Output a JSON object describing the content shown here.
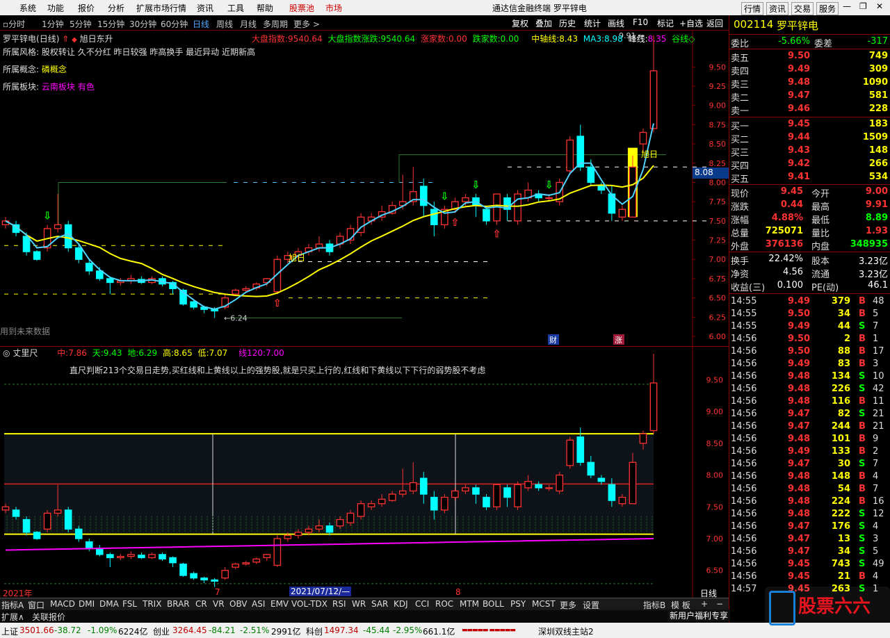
{
  "menu": {
    "items": [
      "系统",
      "功能",
      "报价",
      "分析",
      "扩展市场行情",
      "资讯",
      "工具",
      "帮助"
    ],
    "stock_pool": "股票池",
    "market": "市场",
    "title": "通达信金融终端 罗平锌电",
    "right": [
      "行情",
      "资讯",
      "交易",
      "服务"
    ]
  },
  "periods": [
    "分时",
    "1分钟",
    "5分钟",
    "15分钟",
    "30分钟",
    "60分钟",
    "日线",
    "周线",
    "月线",
    "多周期",
    "更多 >"
  ],
  "right_tools": [
    "复权",
    "叠加",
    "历史",
    "统计",
    "画线",
    "F10",
    "标记",
    "+自选",
    "返回"
  ],
  "main": {
    "header": {
      "name": "罗平锌电",
      "period": "(日线)",
      "tag": "旭日东升",
      "idx_label": "大盘指数:",
      "idx_value": "9540.64",
      "idx2_label": "大盘指数涨跌:",
      "idx2_value": "9540.64",
      "up_label": "涨家数:",
      "up_value": "0.00",
      "down_label": "跌家数:",
      "down_value": "0.00",
      "mid_label": "中轴线:",
      "mid_value": "8.43",
      "ma3_label": "MA3:",
      "ma3_value": "8.98",
      "peak_label": "峰线:",
      "peak_value": "8.35",
      "valley_label": "谷线◇"
    },
    "info": [
      {
        "label": "所属风格:",
        "value": "股权转让 久不分红 昨日较强 昨高换手 最近异动 近期新高"
      },
      {
        "label": "所属概念:",
        "value": "磷概念"
      },
      {
        "label": "所属板块:",
        "value": "云南板块 有色"
      }
    ],
    "annot": {
      "future": "用到未来数据",
      "low": "6.24",
      "high": "9.91",
      "xuri": "旭日",
      "cai": "财",
      "zhang": "涨",
      "price_tag": "8.08"
    }
  },
  "sub": {
    "header": {
      "name": "丈里尺",
      "mid_label": "中:",
      "mid_value": "7.86",
      "tian_label": "天:",
      "tian_value": "9.43",
      "di_label": "地:",
      "di_value": "6.29",
      "gao_label": "高:",
      "gao_value": "8.65",
      "di2_label": "低:",
      "di2_value": "7.07",
      "line_label": "线120:",
      "line_value": "7.00"
    },
    "desc": "直尺判断213个交易日走势,买红线和上黄线以上的强势股,就是只买上行的,红线和下黄线以下下行的弱势股不考虑",
    "axis": {
      "year": "2021年",
      "m7": "7",
      "date": "2021/07/12/—",
      "m8": "8",
      "period": "日线"
    }
  },
  "bottom_tabs": [
    "指标A",
    "窗口",
    "MACD",
    "DMI",
    "DMA",
    "FSL",
    "TRIX",
    "BRAR",
    "CR",
    "VR",
    "OBV",
    "ASI",
    "EMV",
    "VOL-TDX",
    "RSI",
    "WR",
    "SAR",
    "KDJ",
    "CCI",
    "ROC",
    "MTM",
    "BOLL",
    "PSY",
    "MCST",
    "更多",
    "设置"
  ],
  "bottom_right": [
    "指标B",
    "模 板",
    "+",
    "−"
  ],
  "ext": [
    "扩展∧",
    "关联报价"
  ],
  "status": {
    "sh_label": "上证",
    "sh": "3501.66",
    "sh_chg": "-38.72",
    "sh_pct": "-1.09%",
    "sh_amt": "6224亿",
    "cy_label": "创业",
    "cy": "3264.45",
    "cy_chg": "-84.21",
    "cy_pct": "-2.51%",
    "cy_amt": "2991亿",
    "kc_label": "科创",
    "kc": "1497.34",
    "kc_chg": "-45.44",
    "kc_pct": "-2.95%",
    "kc_amt": "661.1亿",
    "station": "深圳双线主站2",
    "promo": "新用户福利专享",
    "logo": "股票六六"
  },
  "quote": {
    "code": "002114",
    "name": "罗平锌电",
    "wb_label": "委比",
    "wb": "-5.66%",
    "wc_label": "委差",
    "wc": "-317",
    "sells": [
      {
        "l": "卖五",
        "p": "9.50",
        "v": "749"
      },
      {
        "l": "卖四",
        "p": "9.49",
        "v": "309"
      },
      {
        "l": "卖三",
        "p": "9.48",
        "v": "1090"
      },
      {
        "l": "卖二",
        "p": "9.47",
        "v": "581"
      },
      {
        "l": "卖一",
        "p": "9.46",
        "v": "228"
      }
    ],
    "buys": [
      {
        "l": "买一",
        "p": "9.45",
        "v": "183"
      },
      {
        "l": "买二",
        "p": "9.44",
        "v": "1509"
      },
      {
        "l": "买三",
        "p": "9.43",
        "v": "148"
      },
      {
        "l": "买四",
        "p": "9.42",
        "v": "266"
      },
      {
        "l": "买五",
        "p": "9.41",
        "v": "534"
      }
    ],
    "stats": [
      {
        "l1": "现价",
        "v1": "9.45",
        "l2": "今开",
        "v2": "9.00"
      },
      {
        "l1": "涨跌",
        "v1": "0.44",
        "l2": "最高",
        "v2": "9.91"
      },
      {
        "l1": "涨幅",
        "v1": "4.88%",
        "l2": "最低",
        "v2": "8.89"
      },
      {
        "l1": "总量",
        "v1": "725071",
        "l2": "量比",
        "v2": "1.93"
      },
      {
        "l1": "外盘",
        "v1": "376136",
        "l2": "内盘",
        "v2": "348935"
      }
    ],
    "stats2": [
      {
        "l1": "换手",
        "v1": "22.42%",
        "l2": "股本",
        "v2": "3.23亿"
      },
      {
        "l1": "净资",
        "v1": "4.56",
        "l2": "流通",
        "v2": "3.23亿"
      },
      {
        "l1": "收益(三)",
        "v1": "0.100",
        "l2": "PE(动)",
        "v2": "46.1"
      }
    ],
    "ticks": [
      [
        "14:55",
        "9.49",
        "379",
        "B",
        "48"
      ],
      [
        "14:55",
        "9.50",
        "34",
        "B",
        "5"
      ],
      [
        "14:55",
        "9.49",
        "44",
        "S",
        "7"
      ],
      [
        "14:56",
        "9.50",
        "2",
        "B",
        "1"
      ],
      [
        "14:56",
        "9.50",
        "88",
        "B",
        "17"
      ],
      [
        "14:56",
        "9.49",
        "83",
        "B",
        "3"
      ],
      [
        "14:56",
        "9.48",
        "134",
        "S",
        "10"
      ],
      [
        "14:56",
        "9.48",
        "226",
        "S",
        "42"
      ],
      [
        "14:56",
        "9.48",
        "116",
        "B",
        "11"
      ],
      [
        "14:56",
        "9.47",
        "82",
        "S",
        "21"
      ],
      [
        "14:56",
        "9.47",
        "244",
        "B",
        "21"
      ],
      [
        "14:56",
        "9.48",
        "101",
        "B",
        "9"
      ],
      [
        "14:56",
        "9.49",
        "133",
        "B",
        "2"
      ],
      [
        "14:56",
        "9.47",
        "30",
        "S",
        "7"
      ],
      [
        "14:56",
        "9.48",
        "148",
        "B",
        "4"
      ],
      [
        "14:56",
        "9.48",
        "54",
        "B",
        "7"
      ],
      [
        "14:56",
        "9.48",
        "224",
        "B",
        "16"
      ],
      [
        "14:56",
        "9.48",
        "222",
        "S",
        "12"
      ],
      [
        "14:56",
        "9.47",
        "176",
        "S",
        "4"
      ],
      [
        "14:56",
        "9.47",
        "13",
        "S",
        "3"
      ],
      [
        "14:56",
        "9.47",
        "34",
        "S",
        "5"
      ],
      [
        "14:56",
        "9.45",
        "743",
        "S",
        "49"
      ],
      [
        "14:56",
        "9.45",
        "21",
        "B",
        "4"
      ],
      [
        "14:57",
        "9.45",
        "263",
        "S",
        "1"
      ]
    ]
  },
  "colors": {
    "up": "#ff3232",
    "down": "#00ffff",
    "yellow": "#ffff00",
    "green": "#00ff00",
    "magenta": "#ff00ff",
    "white": "#ffffff"
  },
  "chart_data": {
    "type": "candlestick",
    "ylim": [
      6.0,
      9.9
    ],
    "y_ticks": [
      "9.50",
      "9.25",
      "9.00",
      "8.75",
      "8.50",
      "8.25",
      "8.00",
      "7.75",
      "7.50",
      "7.25",
      "7.00",
      "6.75",
      "6.50",
      "6.25",
      "6.00"
    ],
    "sub_ylim": [
      6.3,
      9.8
    ],
    "sub_ticks": [
      "9.50",
      "9.00",
      "8.50",
      "8.00",
      "7.50",
      "7.00",
      "6.50"
    ],
    "candles": [
      [
        7.45,
        7.5,
        7.55,
        7.4
      ],
      [
        7.45,
        7.35,
        7.5,
        7.3
      ],
      [
        7.3,
        7.1,
        7.35,
        7.05
      ],
      [
        7.1,
        7.0,
        7.12,
        6.98
      ],
      [
        7.15,
        7.4,
        7.45,
        7.1
      ],
      [
        7.4,
        7.45,
        7.85,
        7.35
      ],
      [
        7.45,
        7.15,
        7.5,
        7.1
      ],
      [
        7.15,
        7.0,
        7.2,
        6.95
      ],
      [
        6.95,
        6.85,
        7.0,
        6.8
      ],
      [
        6.85,
        6.75,
        6.9,
        6.72
      ],
      [
        6.75,
        6.7,
        6.78,
        6.55
      ],
      [
        6.7,
        6.72,
        6.76,
        6.66
      ],
      [
        6.72,
        6.75,
        6.8,
        6.68
      ],
      [
        6.74,
        6.7,
        6.78,
        6.68
      ],
      [
        6.7,
        6.75,
        6.78,
        6.68
      ],
      [
        6.75,
        6.68,
        6.78,
        6.65
      ],
      [
        6.7,
        6.62,
        6.72,
        6.55
      ],
      [
        6.6,
        6.42,
        6.62,
        6.4
      ],
      [
        6.45,
        6.38,
        6.48,
        6.35
      ],
      [
        6.38,
        6.35,
        6.4,
        6.3
      ],
      [
        6.35,
        6.33,
        6.38,
        6.24
      ],
      [
        6.38,
        6.5,
        6.55,
        6.35
      ],
      [
        6.55,
        6.6,
        6.62,
        6.52
      ],
      [
        6.6,
        6.62,
        6.65,
        6.58
      ],
      [
        6.63,
        6.68,
        6.7,
        6.6
      ],
      [
        6.7,
        6.75,
        6.76,
        6.65
      ],
      [
        6.58,
        7.0,
        7.05,
        6.55
      ],
      [
        7.0,
        7.05,
        7.1,
        6.95
      ],
      [
        7.05,
        7.1,
        7.15,
        7.0
      ],
      [
        7.1,
        7.15,
        7.2,
        7.05
      ],
      [
        7.15,
        7.2,
        7.3,
        7.1
      ],
      [
        7.2,
        7.1,
        7.25,
        7.05
      ],
      [
        7.2,
        7.3,
        7.35,
        7.15
      ],
      [
        7.25,
        7.4,
        7.45,
        7.2
      ],
      [
        7.35,
        7.55,
        7.6,
        7.3
      ],
      [
        7.5,
        7.55,
        7.6,
        7.45
      ],
      [
        7.55,
        7.62,
        7.7,
        7.5
      ],
      [
        7.6,
        7.7,
        7.75,
        7.58
      ],
      [
        7.7,
        7.75,
        8.1,
        7.65
      ],
      [
        7.75,
        7.88,
        8.2,
        7.7
      ],
      [
        7.95,
        7.7,
        8.05,
        7.55
      ],
      [
        7.65,
        7.45,
        7.75,
        7.3
      ],
      [
        7.45,
        7.65,
        7.7,
        7.4
      ],
      [
        7.65,
        7.75,
        7.8,
        7.6
      ],
      [
        7.75,
        7.8,
        7.85,
        7.7
      ],
      [
        7.8,
        7.7,
        7.85,
        7.55
      ],
      [
        7.65,
        7.5,
        7.7,
        7.45
      ],
      [
        7.5,
        7.85,
        7.85,
        7.45
      ],
      [
        7.8,
        7.65,
        7.85,
        7.5
      ],
      [
        7.5,
        7.85,
        7.9,
        7.45
      ],
      [
        7.8,
        7.9,
        8.0,
        7.75
      ],
      [
        7.85,
        7.8,
        7.9,
        7.75
      ],
      [
        7.8,
        7.8,
        7.85,
        7.75
      ],
      [
        7.75,
        8.0,
        8.05,
        7.7
      ],
      [
        8.15,
        8.55,
        8.6,
        8.1
      ],
      [
        8.6,
        8.2,
        8.75,
        8.15
      ],
      [
        8.2,
        8.0,
        8.3,
        7.95
      ],
      [
        7.95,
        7.9,
        8.0,
        7.85
      ],
      [
        7.85,
        7.6,
        7.95,
        7.5
      ],
      [
        7.55,
        7.65,
        7.7,
        7.5
      ],
      [
        7.55,
        8.2,
        8.35,
        7.55
      ],
      [
        8.5,
        8.65,
        8.7,
        8.4
      ],
      [
        8.7,
        9.45,
        9.91,
        8.65
      ]
    ]
  }
}
